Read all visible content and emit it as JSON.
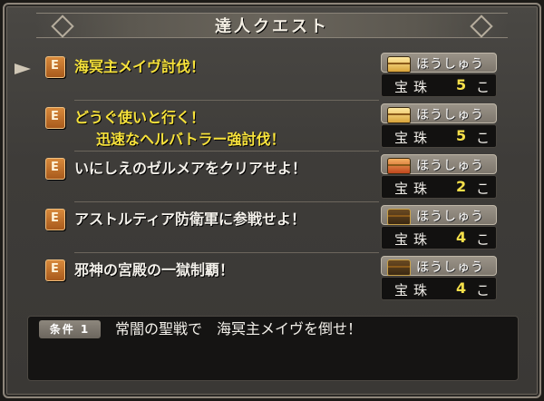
{
  "window": {
    "title": "達人クエスト"
  },
  "quests": [
    {
      "title_line1": "海冥主メイヴ討伐！",
      "title_line2": "",
      "text_color": "yellow",
      "chest": "gold",
      "reward": {
        "label": "ほうしゅう",
        "item": "宝珠",
        "count": "5",
        "unit": "こ"
      }
    },
    {
      "title_line1": "どうぐ使いと行く！",
      "title_line2": "迅速なヘルバトラー強討伐！",
      "text_color": "yellow",
      "chest": "gold",
      "reward": {
        "label": "ほうしゅう",
        "item": "宝珠",
        "count": "5",
        "unit": "こ"
      }
    },
    {
      "title_line1": "いにしえのゼルメアをクリアせよ！",
      "title_line2": "",
      "text_color": "white",
      "chest": "red",
      "reward": {
        "label": "ほうしゅう",
        "item": "宝珠",
        "count": "2",
        "unit": "こ"
      }
    },
    {
      "title_line1": "アストルティア防衛軍に参戦せよ！",
      "title_line2": "",
      "text_color": "white",
      "chest": "dark",
      "reward": {
        "label": "ほうしゅう",
        "item": "宝珠",
        "count": "4",
        "unit": "こ"
      }
    },
    {
      "title_line1": "邪神の宮殿の一獄制覇！",
      "title_line2": "",
      "text_color": "white",
      "chest": "dark",
      "reward": {
        "label": "ほうしゅう",
        "item": "宝珠",
        "count": "4",
        "unit": "こ"
      }
    }
  ],
  "condition": {
    "badge": "条件 1",
    "text": "常闇の聖戦で　海冥主メイヴを倒せ！"
  }
}
